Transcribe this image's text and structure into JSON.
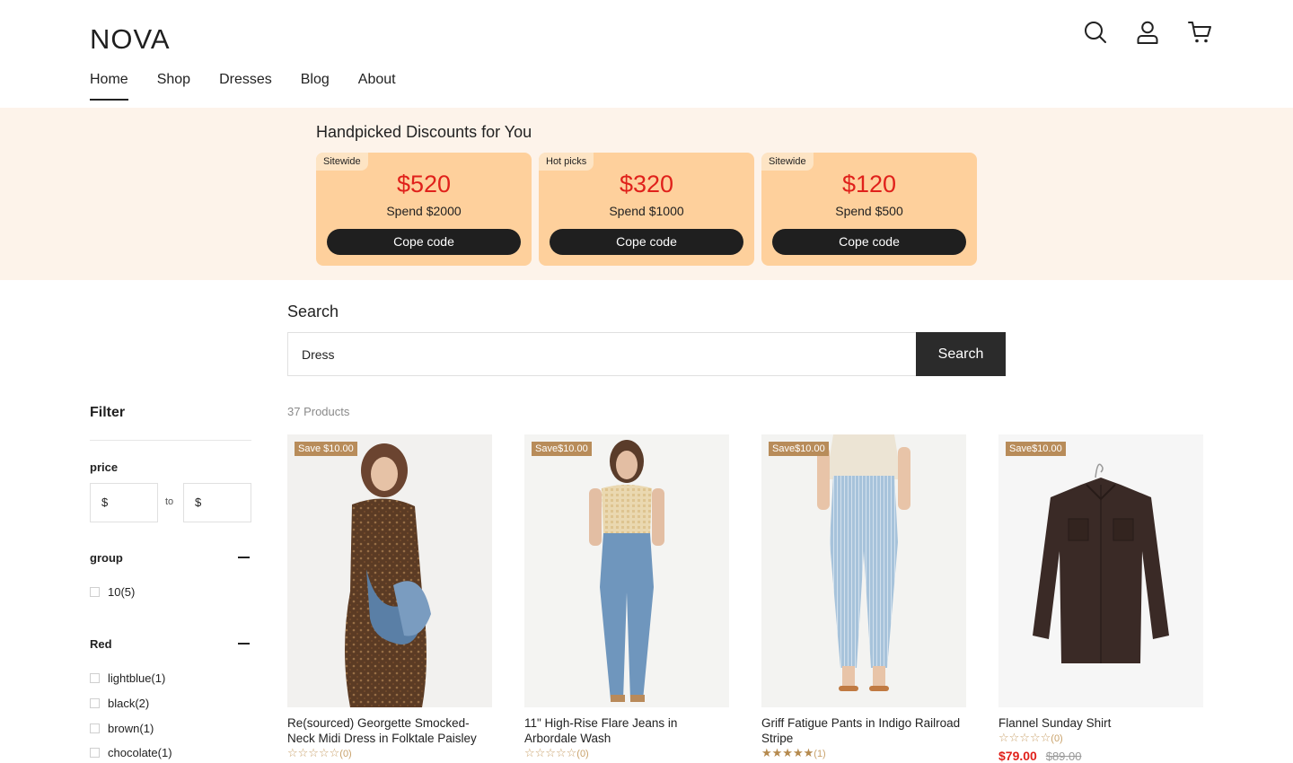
{
  "brand": {
    "logo": "NOVA"
  },
  "header": {
    "nav": [
      {
        "label": "Home",
        "active": true
      },
      {
        "label": "Shop"
      },
      {
        "label": "Dresses"
      },
      {
        "label": "Blog"
      },
      {
        "label": "About"
      }
    ],
    "icons": [
      "search-icon",
      "user-icon",
      "cart-icon"
    ]
  },
  "promo": {
    "title": "Handpicked Discounts for You",
    "coupons": [
      {
        "tag": "Sitewide",
        "amount": "$520",
        "spend": "Spend $2000",
        "button": "Cope code"
      },
      {
        "tag": "Hot picks",
        "amount": "$320",
        "spend": "Spend $1000",
        "button": "Cope code"
      },
      {
        "tag": "Sitewide",
        "amount": "$120",
        "spend": "Spend $500",
        "button": "Cope code"
      }
    ]
  },
  "search": {
    "label": "Search",
    "value": "Dress",
    "button": "Search"
  },
  "filter": {
    "title": "Filter",
    "price": {
      "title": "price",
      "from_symbol": "$",
      "to_label": "to",
      "to_symbol": "$"
    },
    "group": {
      "title": "group",
      "options": [
        "10(5)"
      ]
    },
    "red": {
      "title": "Red",
      "options": [
        "lightblue(1)",
        "black(2)",
        "brown(1)",
        "chocolate(1)"
      ]
    }
  },
  "results": {
    "count": "37 Products",
    "products": [
      {
        "save": "Save $10.00",
        "title": "Re(sourced) Georgette Smocked-Neck Midi Dress in Folktale Paisley",
        "stars": "☆☆☆☆☆",
        "reviews": "(0)"
      },
      {
        "save": "Save$10.00",
        "title": "11\" High-Rise Flare Jeans in Arbordale Wash",
        "stars": "☆☆☆☆☆",
        "reviews": "(0)"
      },
      {
        "save": "Save$10.00",
        "title": "Griff Fatigue Pants in Indigo Railroad Stripe",
        "stars": "★★★★★",
        "reviews": "(1)"
      },
      {
        "save": "Save$10.00",
        "title": "Flannel Sunday Shirt",
        "stars": "☆☆☆☆☆",
        "reviews": "(0)",
        "price_now": "$79.00",
        "price_old": "$89.00"
      }
    ]
  },
  "colors": {
    "accent_red": "#e0211b",
    "coupon_bg": "#fed09c",
    "promo_bg": "#fdf3ea",
    "save_tag": "#b88c5a",
    "dark": "#1f1f1f"
  }
}
